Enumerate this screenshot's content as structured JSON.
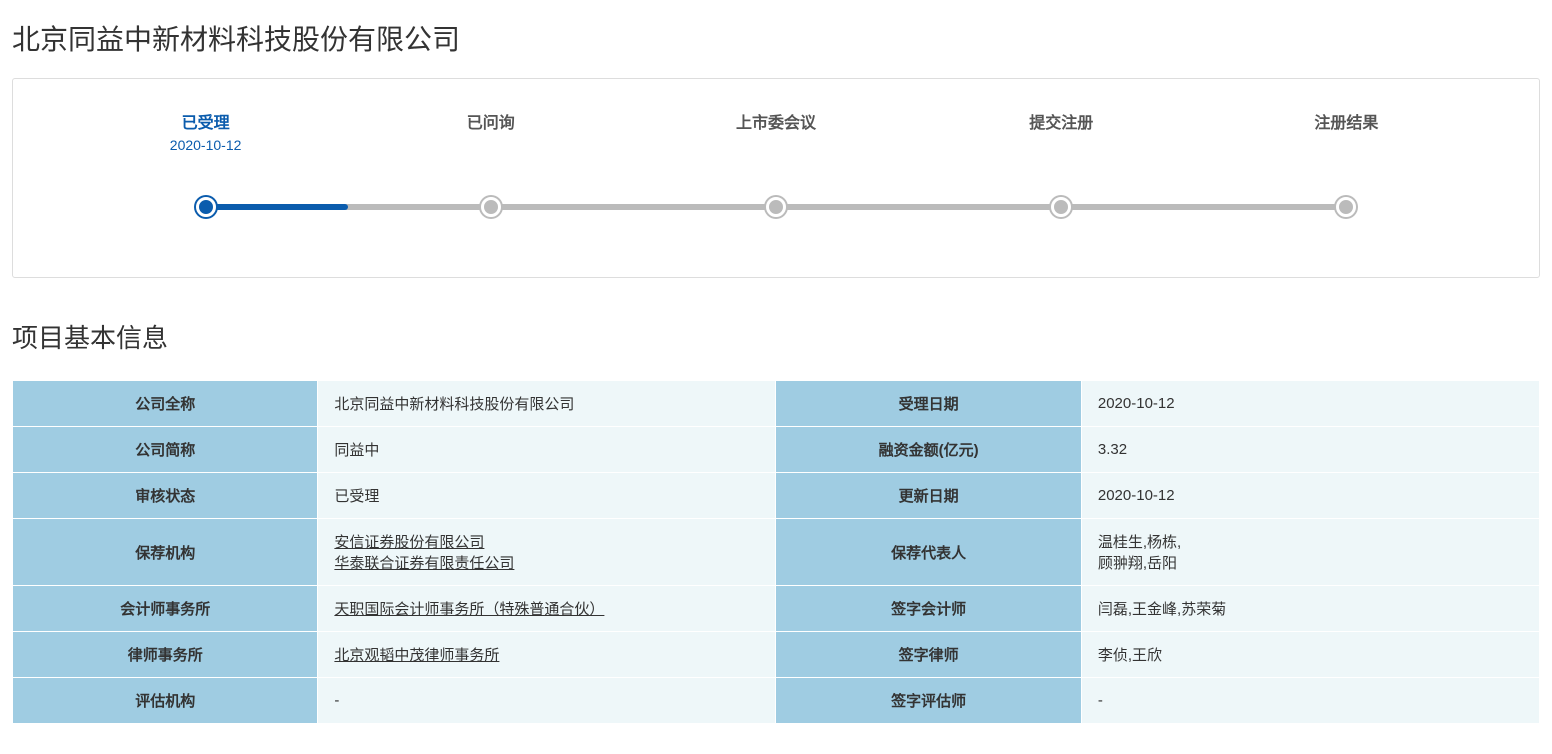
{
  "page_title": "北京同益中新材料科技股份有限公司",
  "progress": {
    "steps": [
      {
        "label": "已受理",
        "date": "2020-10-12",
        "active": true
      },
      {
        "label": "已问询",
        "date": "",
        "active": false
      },
      {
        "label": "上市委会议",
        "date": "",
        "active": false
      },
      {
        "label": "提交注册",
        "date": "",
        "active": false
      },
      {
        "label": "注册结果",
        "date": "",
        "active": false
      }
    ]
  },
  "section_title": "项目基本信息",
  "info": {
    "company_full_name_label": "公司全称",
    "company_full_name": "北京同益中新材料科技股份有限公司",
    "accept_date_label": "受理日期",
    "accept_date": "2020-10-12",
    "company_short_name_label": "公司简称",
    "company_short_name": "同益中",
    "financing_amount_label": "融资金额(亿元)",
    "financing_amount": "3.32",
    "audit_status_label": "审核状态",
    "audit_status": "已受理",
    "update_date_label": "更新日期",
    "update_date": "2020-10-12",
    "sponsor_org_label": "保荐机构",
    "sponsor_org_1": "安信证券股份有限公司",
    "sponsor_org_2": "华泰联合证券有限责任公司",
    "sponsor_rep_label": "保荐代表人",
    "sponsor_rep_1": "温桂生,杨栋,",
    "sponsor_rep_2": "顾翀翔,岳阳",
    "accounting_firm_label": "会计师事务所",
    "accounting_firm": "天职国际会计师事务所（特殊普通合伙）",
    "sign_accountant_label": "签字会计师",
    "sign_accountant": "闫磊,王金峰,苏荣菊",
    "law_firm_label": "律师事务所",
    "law_firm": "北京观韬中茂律师事务所",
    "sign_lawyer_label": "签字律师",
    "sign_lawyer": "李侦,王欣",
    "appraisal_org_label": "评估机构",
    "appraisal_org": "-",
    "sign_appraiser_label": "签字评估师",
    "sign_appraiser": "-"
  }
}
